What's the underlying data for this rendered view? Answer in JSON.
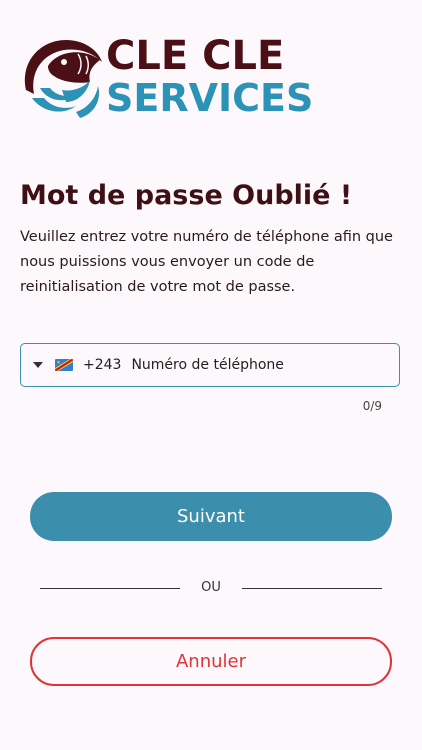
{
  "logo": {
    "line1": "CLE CLE",
    "line2": "SERVICES",
    "icon": "fish-wave-logo-icon"
  },
  "page": {
    "title": "Mot de passe Oublié !",
    "description": "Veuillez entrez votre numéro de téléphone afin que nous puissions vous envoyer un code de reinitialisation de votre mot de passe."
  },
  "phone": {
    "dial_code": "+243",
    "placeholder": "Numéro de téléphone",
    "value": "",
    "counter": "0/9",
    "country_flag": "flag-drc-icon",
    "dropdown_icon": "caret-down-icon"
  },
  "actions": {
    "next_label": "Suivant",
    "or_label": "OU",
    "cancel_label": "Annuler"
  },
  "colors": {
    "background": "#fdf8fb",
    "brand_dark": "#4a1016",
    "brand_blue": "#2a93b6",
    "primary_button": "#3b8eac",
    "cancel": "#e03436"
  }
}
